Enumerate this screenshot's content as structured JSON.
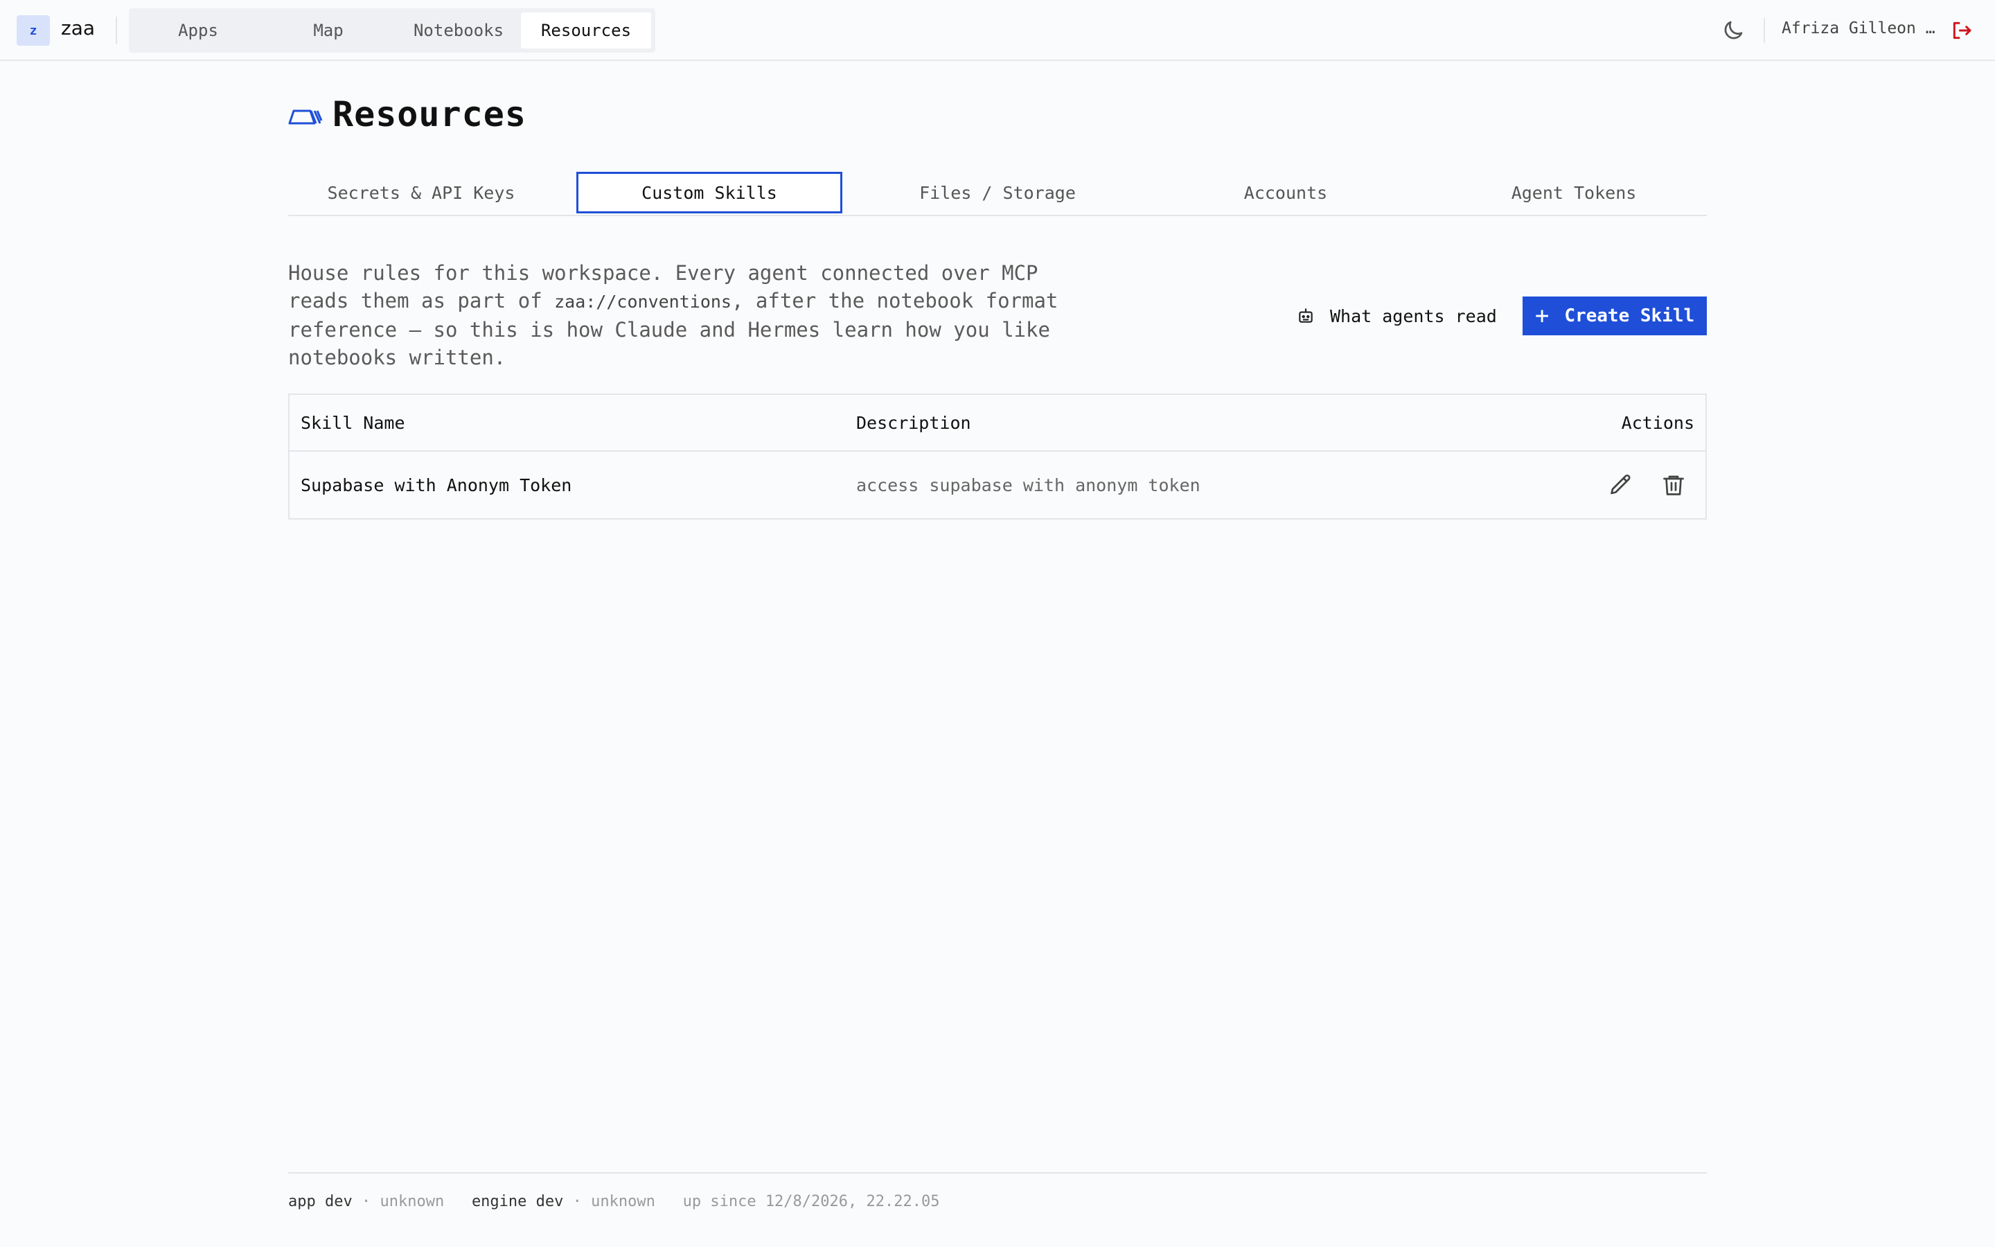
{
  "app": {
    "logo_letter": "z",
    "name": "zaa"
  },
  "nav": {
    "items": [
      {
        "label": "Apps",
        "active": false
      },
      {
        "label": "Map",
        "active": false
      },
      {
        "label": "Notebooks",
        "active": false
      },
      {
        "label": "Resources",
        "active": true
      }
    ]
  },
  "topbar": {
    "theme_icon": "moon-icon",
    "user_name": "Afriza Gilleon …",
    "logout_icon": "logout-icon"
  },
  "page": {
    "icon": "resources-icon",
    "title": "Resources"
  },
  "tabs": [
    {
      "label": "Secrets & API Keys",
      "active": false
    },
    {
      "label": "Custom Skills",
      "active": true
    },
    {
      "label": "Files / Storage",
      "active": false
    },
    {
      "label": "Accounts",
      "active": false
    },
    {
      "label": "Agent Tokens",
      "active": false
    }
  ],
  "intro": {
    "part1": "House rules for this workspace. Every agent connected over MCP reads them as part of ",
    "code": "zaa://conventions",
    "part2": ", after the notebook format reference — so this is how Claude and Hermes learn how you like notebooks written."
  },
  "actions": {
    "what_agents_read": "What agents read",
    "create_skill": "Create Skill"
  },
  "table": {
    "headers": {
      "name": "Skill Name",
      "description": "Description",
      "actions": "Actions"
    },
    "rows": [
      {
        "name": "Supabase with Anonym Token",
        "description": "access supabase with anonym token"
      }
    ]
  },
  "footer": {
    "app_label": "app dev",
    "app_version": "unknown",
    "engine_label": "engine dev",
    "engine_version": "unknown",
    "uptime": "up since 12/8/2026, 22.22.05",
    "separator": "·"
  },
  "colors": {
    "accent": "#1f4fd8",
    "logout": "#d0141c"
  }
}
